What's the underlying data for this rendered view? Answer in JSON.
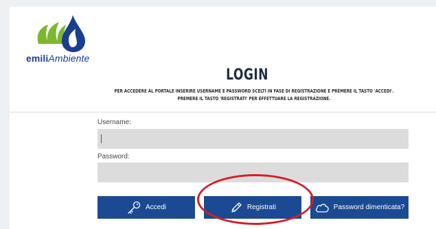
{
  "brand": {
    "name_bold": "emili",
    "name_light": "Ambiente",
    "logo_icon": "emiliambiente-logo-icon",
    "colors": {
      "primary": "#1b4a93",
      "logo_blue": "#1b3f8f",
      "logo_green": "#7cb82f",
      "highlight": "#d21f26"
    }
  },
  "header": {
    "title": "LOGIN",
    "instructions_line1": "PER ACCEDERE AL PORTALE INSERIRE USERNAME E PASSWORD SCELTI IN FASE DI REGISTRAZIONE E PREMERE IL TASTO 'ACCEDI'.",
    "instructions_line2": "PREMERE IL TASTO 'REGISTRATI' PER EFFETTUARE LA REGISTRAZIONE."
  },
  "form": {
    "username_label": "Username:",
    "username_value": "",
    "password_label": "Password:",
    "password_value": ""
  },
  "actions": {
    "login_label": "Accedi",
    "login_icon": "key-icon",
    "register_label": "Registrati",
    "register_icon": "pencil-icon",
    "forgot_label": "Password dimenticata?",
    "forgot_icon": "cloud-icon"
  }
}
